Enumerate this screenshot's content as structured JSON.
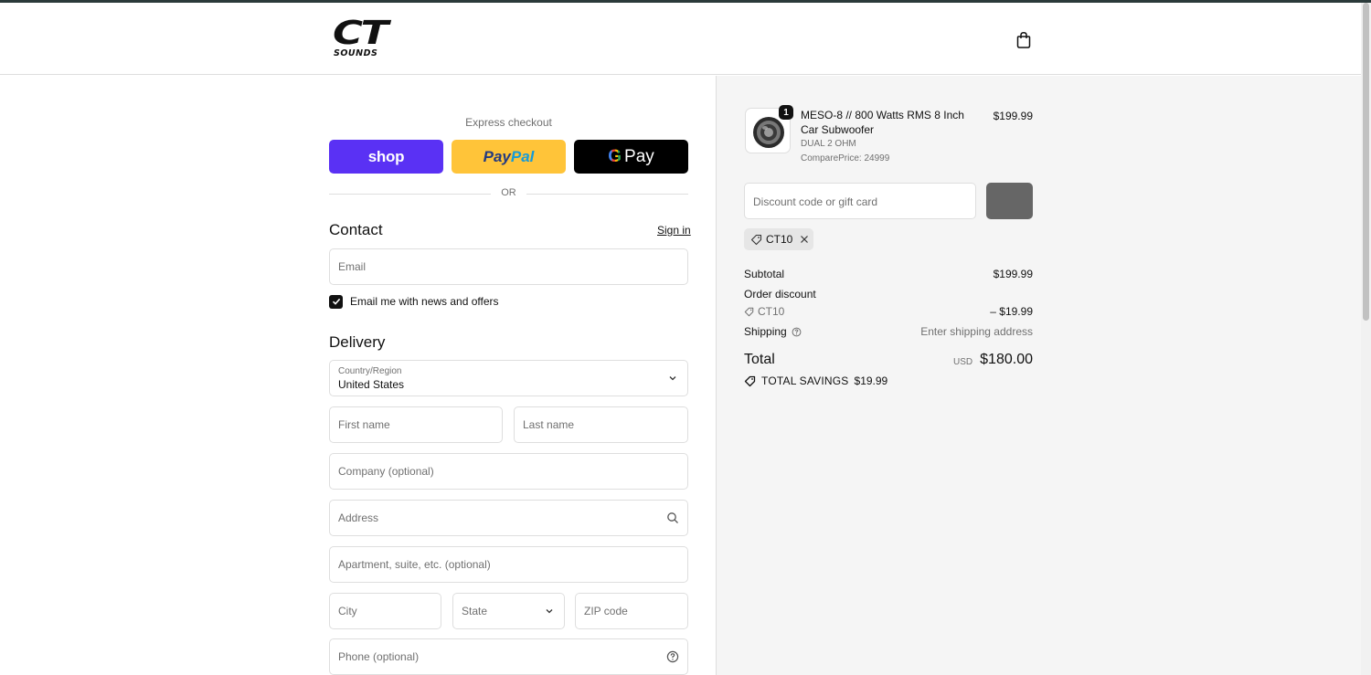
{
  "brand": {
    "logo_main": "CT",
    "logo_sub": "SOUNDS"
  },
  "express": {
    "title": "Express checkout",
    "shop_label": "shop",
    "paypal_label_1": "Pay",
    "paypal_label_2": "Pal",
    "gpay_g": "G",
    "gpay_label": "Pay",
    "or_label": "OR"
  },
  "contact": {
    "title": "Contact",
    "signin_label": "Sign in",
    "email_placeholder": "Email",
    "newsletter_label": "Email me with news and offers",
    "newsletter_checked": true
  },
  "delivery": {
    "title": "Delivery",
    "country_label": "Country/Region",
    "country_value": "United States",
    "first_name_placeholder": "First name",
    "last_name_placeholder": "Last name",
    "company_placeholder": "Company (optional)",
    "address_placeholder": "Address",
    "apartment_placeholder": "Apartment, suite, etc. (optional)",
    "city_placeholder": "City",
    "state_placeholder": "State",
    "zip_placeholder": "ZIP code",
    "phone_placeholder": "Phone (optional)"
  },
  "order": {
    "product": {
      "quantity": "1",
      "name": "MESO-8 // 800 Watts RMS 8 Inch Car Subwoofer",
      "variant": "DUAL 2 OHM",
      "compare_price": "ComparePrice: 24999",
      "price": "$199.99"
    },
    "discount_placeholder": "Discount code or gift card",
    "applied_code": "CT10",
    "subtotal_label": "Subtotal",
    "subtotal_value": "$199.99",
    "order_discount_label": "Order discount",
    "discount_code": "CT10",
    "discount_value": "– $19.99",
    "shipping_label": "Shipping",
    "shipping_value": "Enter shipping address",
    "total_label": "Total",
    "total_currency": "USD",
    "total_value": "$180.00",
    "savings_label": "TOTAL SAVINGS",
    "savings_value": "$19.99"
  },
  "colors": {
    "shop_purple": "#5a31f4",
    "paypal_yellow": "#ffc439",
    "gpay_black": "#000000",
    "panel_bg": "#f5f5f5"
  },
  "icons": [
    "shopping-bag-icon",
    "checkmark-icon",
    "chevron-down-icon",
    "search-icon",
    "help-circle-icon",
    "tag-icon",
    "close-icon"
  ]
}
